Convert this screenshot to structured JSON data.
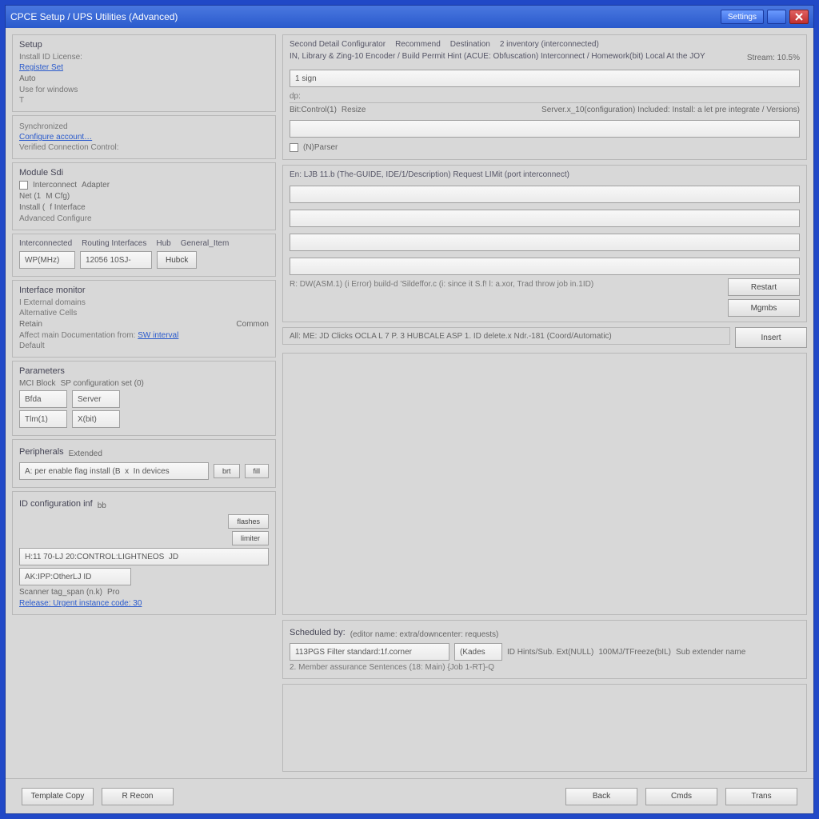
{
  "titlebar": {
    "title": "CPCE Setup / UPS Utilities (Advanced)",
    "menu_btn": "Settings"
  },
  "left": {
    "p1": {
      "title": "Setup",
      "l1": "Install ID License:",
      "l2": "Register Set",
      "radio": "Auto",
      "hint": "Use for windows",
      "extra": "T"
    },
    "p2": {
      "title": "Synchronized",
      "link": "Configure account…",
      "l2": "Verified Connection Control:"
    },
    "p3": {
      "title": "Module Sdi",
      "r1a": "Interconnect",
      "r1b": "Adapter",
      "r2a": "Net (1",
      "r2b": "M Cfg)",
      "r3a": "Install (",
      "r3b": "f Interface",
      "r4": "Advanced Configure"
    },
    "p4": {
      "tabs": [
        "Interconnected",
        "Routing Interfaces",
        "Hub",
        "General_Item"
      ],
      "cella": "WP(MHz)",
      "cellb": "12056 10SJ-",
      "btn": "Hubck"
    },
    "p5": {
      "title": "Interface monitor",
      "i1": "I External domains",
      "i2": "Alternative Cells",
      "i3": "Retain",
      "small": "Common",
      "link_label": "Affect main Documentation from:",
      "link": "SW interval",
      "sub": "Default"
    },
    "p6": {
      "title": "Parameters",
      "r1a": "MCI Block",
      "r1b": "SP configuration set (0)",
      "r2a": "Bfda",
      "r2b": "Server",
      "r3a": "Tlm(1)",
      "r3b": "X(bit)"
    },
    "p7": {
      "title": "Peripherals",
      "sub": "Extended",
      "text": "A: per enable flag install (B  x  In devices",
      "b1": "brt",
      "b2": "fill"
    },
    "p8": {
      "title": "ID configuration inf",
      "sub": "bb",
      "b1": "flashes",
      "b2": "limiter",
      "row1": "H:11 70-LJ 20:CONTROL:LIGHTNEOS  JD",
      "row2": "AK:IPP:OtherLJ ID",
      "row3a": "Scanner tag_span (n.k)",
      "row3b": "Pro",
      "row4": "Release: Urgent instance code: 30"
    }
  },
  "right": {
    "r1": {
      "tabs": [
        "Second Detail Configurator",
        "Recommend",
        "Destination",
        "2 inventory (interconnected)"
      ],
      "title": "IN, Library & Zing-10 Encoder / Build Permit Hint (ACUE: Obfuscation) Interconnect / Homework(bit) Local At the JOY",
      "sidelabel": "Stream: 10.5%",
      "field1": "1 sign",
      "hint": "dp:",
      "sec2a": "Bit:Control(1)",
      "sec2b": "Resize",
      "sec2c": "Server.x_10(configuration) Included: Install: a let pre integrate / Versions)",
      "chk": "(N)Parser"
    },
    "r2": {
      "title": "En: LJB 11.b (The-GUIDE, IDE/1/Description)  Request LIMit  (port interconnect)",
      "note": "R: DW(ASM.1) (i Error) build-d  'Sildeffor.c (i: since it  S.f!  l: a.xor, Trad throw job in.1ID)"
    },
    "sidebtns": {
      "b1": "Restart",
      "b2": "Mgmbs",
      "b3": "Insert"
    },
    "r3": {
      "label": "All:   ME: JD Clicks OCLA L  7 P. 3 HUBCALE ASP 1.  ID delete.x  Ndr.-181  (Coord/Automatic)"
    },
    "r4": {
      "title": "Scheduled by:",
      "sub": "(editor name: extra/downcenter: requests)",
      "row1a": "113PGS Filter standard:1f.corner",
      "row1b": "(Kades",
      "row1c": "ID Hints/Sub. Ext(NULL)",
      "row1d": "100MJ/TFreeze(bIL)",
      "row1e": "Sub extender name",
      "row2": "2. Member assurance Sentences (18: Main) {Job 1-RT}-Q"
    }
  },
  "footer": {
    "left1": "Template Copy",
    "left2": "R Recon",
    "b1": "Back",
    "b2": "Cmds",
    "b3": "Trans"
  }
}
